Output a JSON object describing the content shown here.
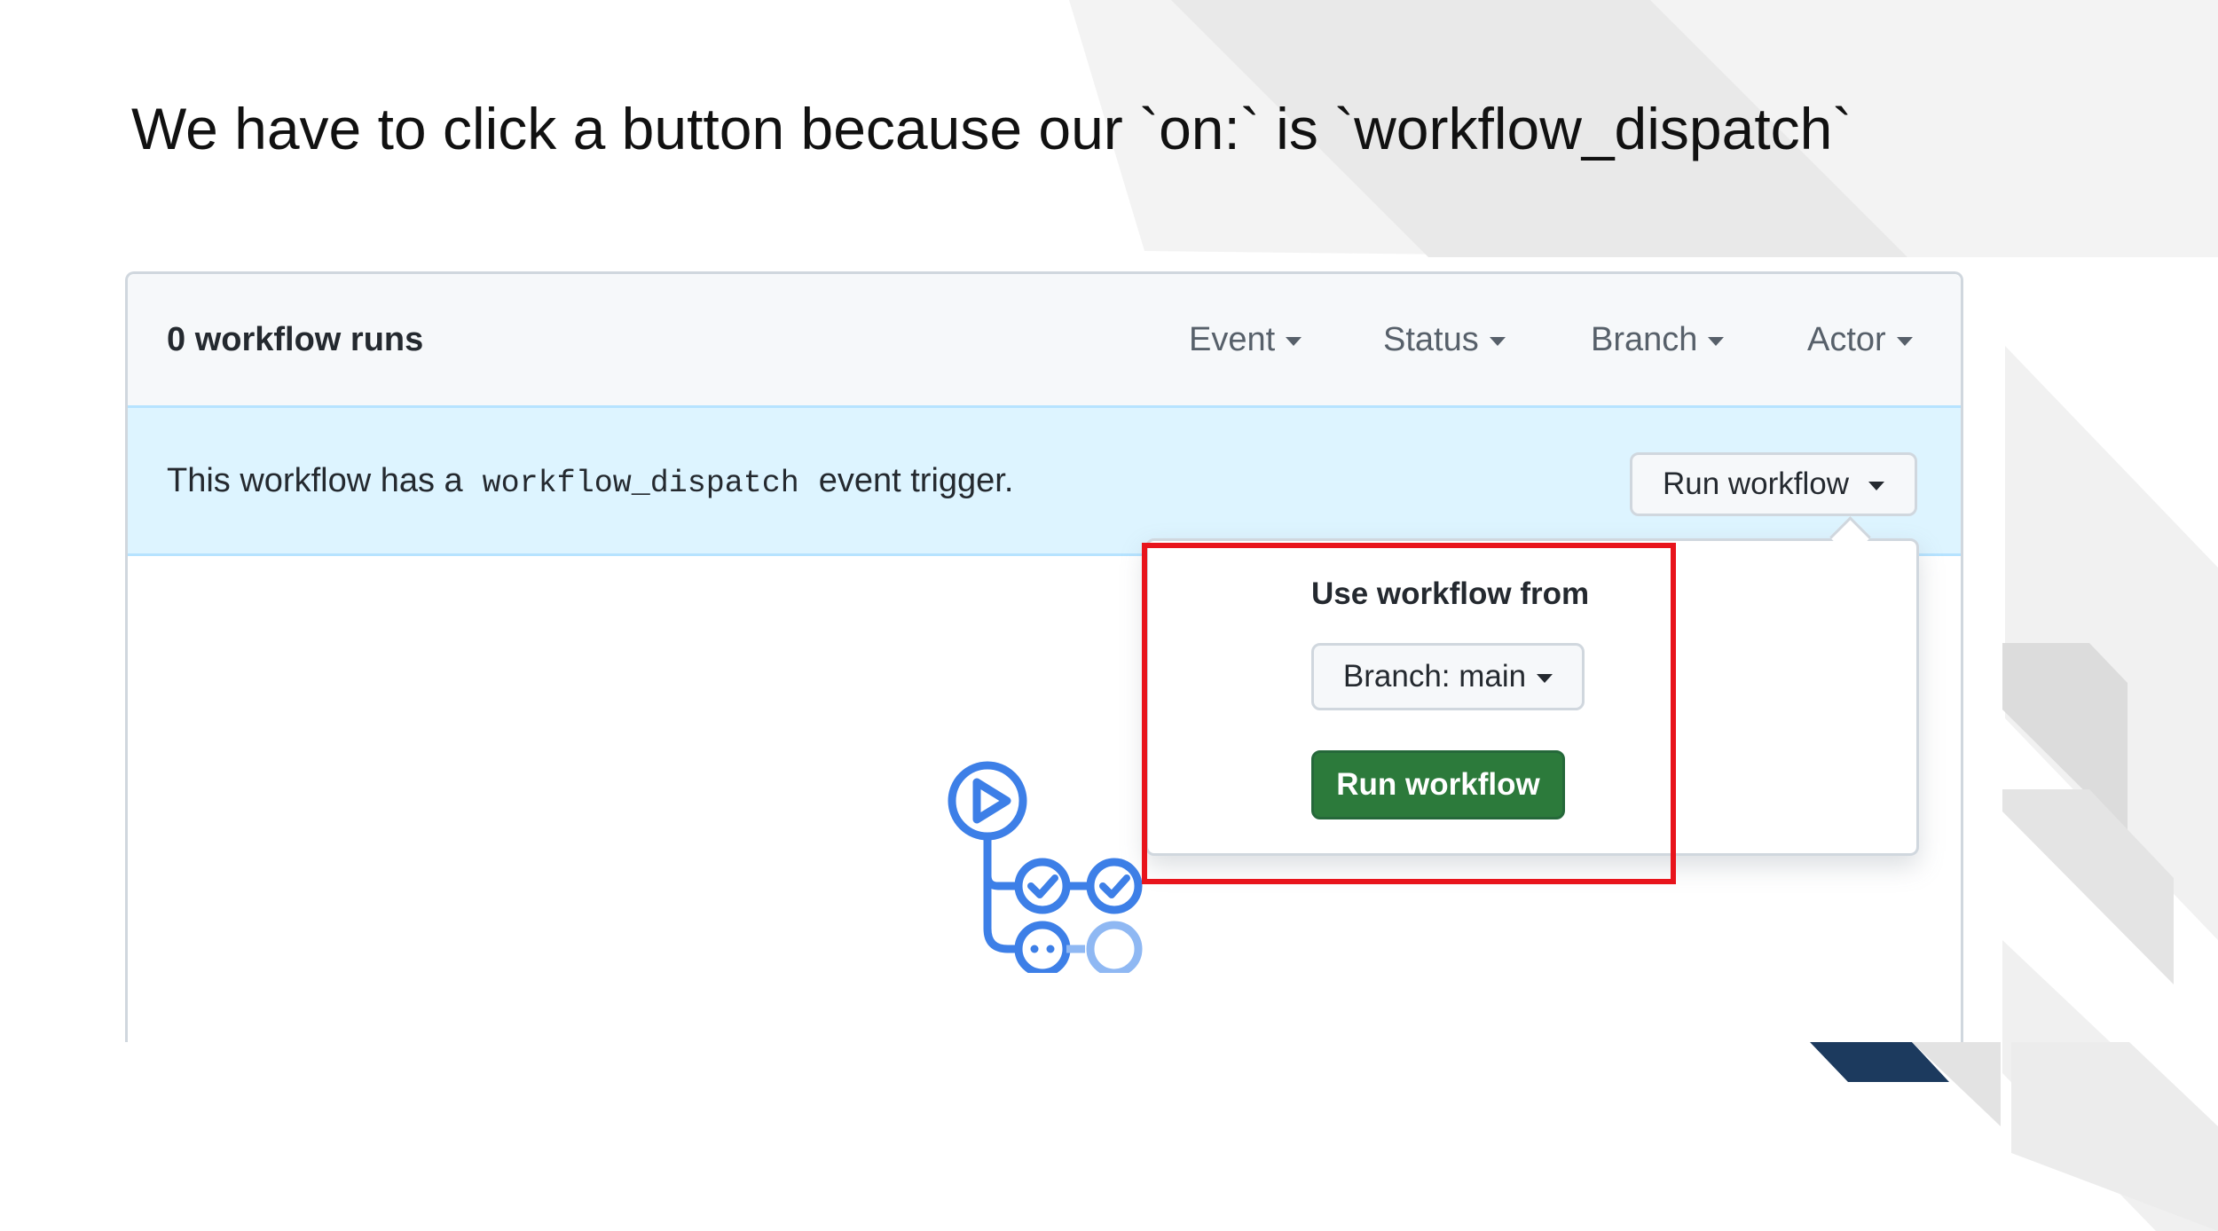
{
  "slide": {
    "title": "We have to click a button because our `on:` is `workflow_dispatch`"
  },
  "actions_page": {
    "runs_count": "0 workflow runs",
    "filters": [
      "Event",
      "Status",
      "Branch",
      "Actor"
    ],
    "banner": {
      "prefix": "This workflow has a",
      "code": "workflow_dispatch",
      "suffix": "event trigger."
    },
    "run_workflow_button": "Run workflow",
    "dropdown": {
      "label": "Use workflow from",
      "branch_button": "Branch: main",
      "run_button": "Run workflow"
    }
  },
  "colors": {
    "banner_bg": "#ddf4ff",
    "run_button_green": "#2c7a3b",
    "highlight_red": "#e8141c",
    "icon_blue": "#3d7fe7",
    "accent_navy": "#1c3a5e"
  },
  "icons": [
    "chevron-down-icon",
    "workflow-empty-icon"
  ]
}
